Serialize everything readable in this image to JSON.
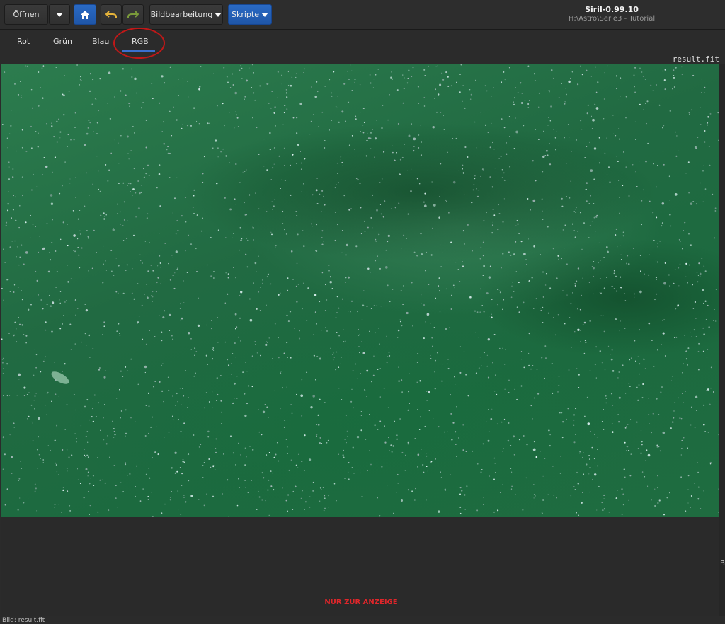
{
  "toolbar": {
    "open_label": "Öffnen",
    "image_processing_label": "Bildbearbeitung",
    "scripts_label": "Skripte",
    "home_icon": "home-icon",
    "undo_icon": "undo-icon",
    "redo_icon": "redo-icon"
  },
  "window": {
    "title": "Siril-0.99.10",
    "subtitle": "H:\\Astro\\Serie3 - Tutorial"
  },
  "tabs": [
    {
      "label": "Rot"
    },
    {
      "label": "Grün"
    },
    {
      "label": "Blau"
    },
    {
      "label": "RGB"
    }
  ],
  "active_tab": "RGB",
  "image": {
    "filename": "result.fit"
  },
  "notice": "NUR ZUR ANZEIGE",
  "edge_label": "B",
  "status_text": "Bild: result.fit",
  "colors": {
    "accent": "#1f56a8",
    "highlight": "#c01818",
    "notice": "#e0262a",
    "image_green": "#216a42"
  }
}
